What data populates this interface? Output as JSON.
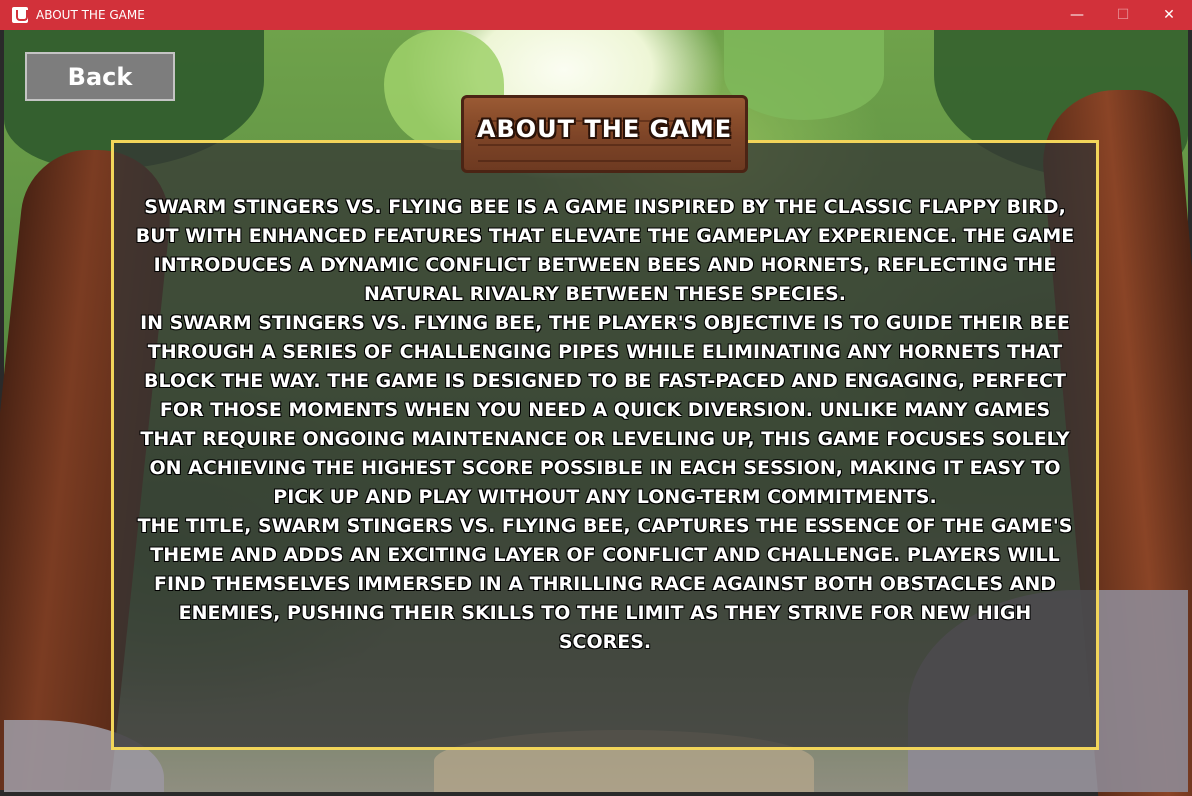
{
  "window": {
    "title": "ABOUT THE GAME",
    "controls": {
      "minimize": "—",
      "maximize": "☐",
      "close": "✕"
    }
  },
  "back_button": {
    "label": "Back"
  },
  "sign": {
    "title": "ABOUT THE GAME"
  },
  "content": {
    "paragraphs": [
      "Swarm Stingers vs. Flying Bee is a game inspired by the classic Flappy Bird, but with enhanced features that elevate the gameplay experience. The game introduces a dynamic conflict between bees and hornets, reflecting the natural rivalry between these species.",
      "In Swarm Stingers vs. Flying Bee, the player's objective is to guide their bee through a series of challenging pipes while eliminating any hornets that block the way. The game is designed to be fast-paced and engaging, perfect for those moments when you need a quick diversion. Unlike many games that require ongoing maintenance or leveling up, this game focuses solely on achieving the highest score possible in each session, making it easy to pick up and play without any long-term commitments.",
      "The title, Swarm Stingers vs. Flying Bee, captures the essence of the game's theme and adds an exciting layer of conflict and challenge. Players will find themselves immersed in a thrilling race against both obstacles and enemies, pushing their skills to the limit as they strive for new high scores."
    ]
  },
  "colors": {
    "titlebar": "#d2313a",
    "panel_border": "#f2d55a",
    "sign_wood": "#8a4d2b"
  }
}
